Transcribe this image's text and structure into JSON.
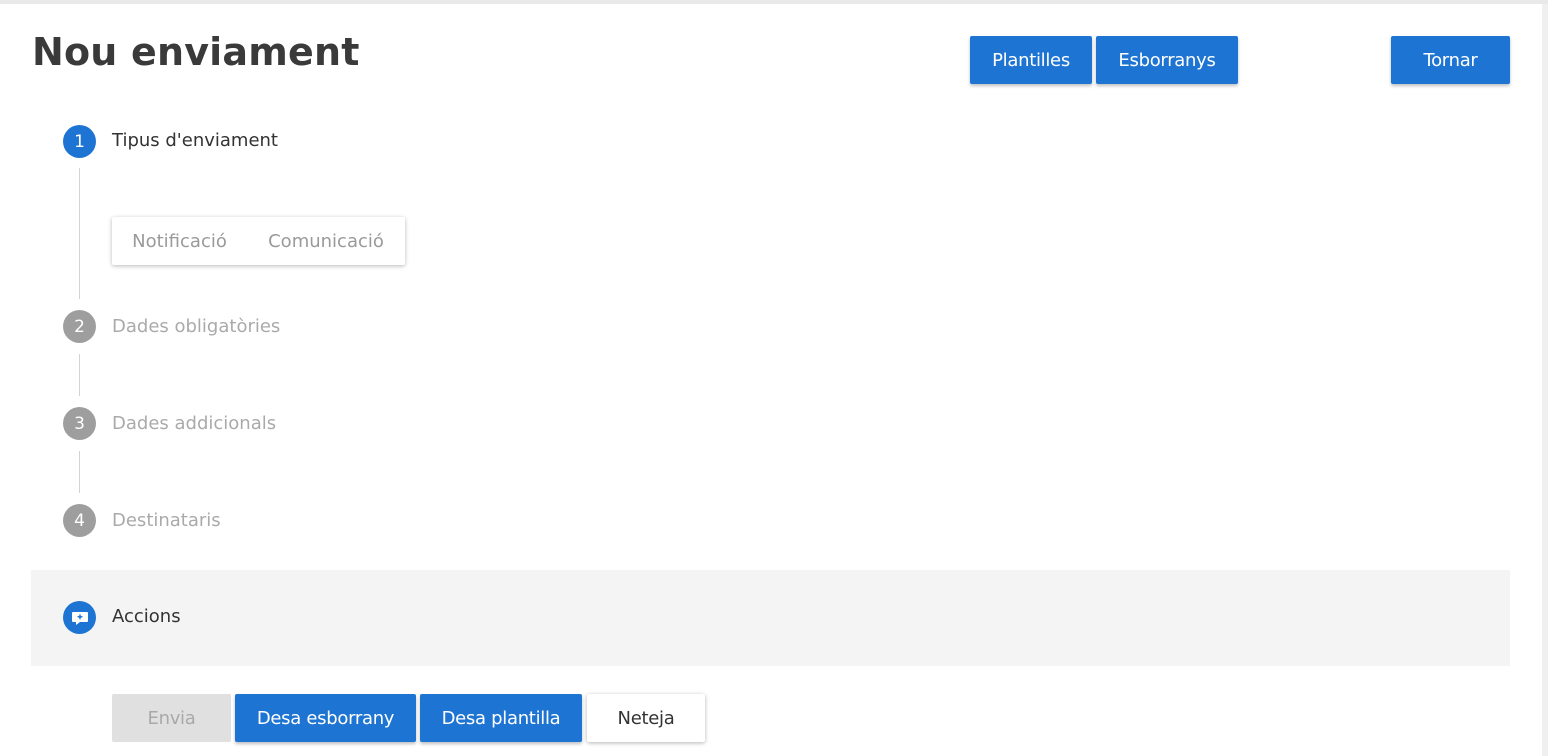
{
  "header": {
    "title": "Nou enviament",
    "templates_label": "Plantilles",
    "drafts_label": "Esborranys",
    "back_label": "Tornar"
  },
  "stepper": {
    "steps": [
      {
        "number": "1",
        "label": "Tipus d'enviament",
        "state": "active"
      },
      {
        "number": "2",
        "label": "Dades obligatòries",
        "state": "inactive"
      },
      {
        "number": "3",
        "label": "Dades addicionals",
        "state": "inactive"
      },
      {
        "number": "4",
        "label": "Destinataris",
        "state": "inactive"
      }
    ],
    "shipment_types": [
      "Notificació",
      "Comunicació"
    ]
  },
  "actions": {
    "label": "Accions",
    "icon": "sparkle-chat-icon",
    "send_label": "Envia",
    "save_draft_label": "Desa esborrany",
    "save_template_label": "Desa plantilla",
    "clear_label": "Neteja"
  },
  "colors": {
    "accent": "#1e74d2",
    "inactive_step": "#9e9e9e",
    "panel_bg": "#f4f4f4",
    "disabled_bg": "#e0e0e0"
  }
}
